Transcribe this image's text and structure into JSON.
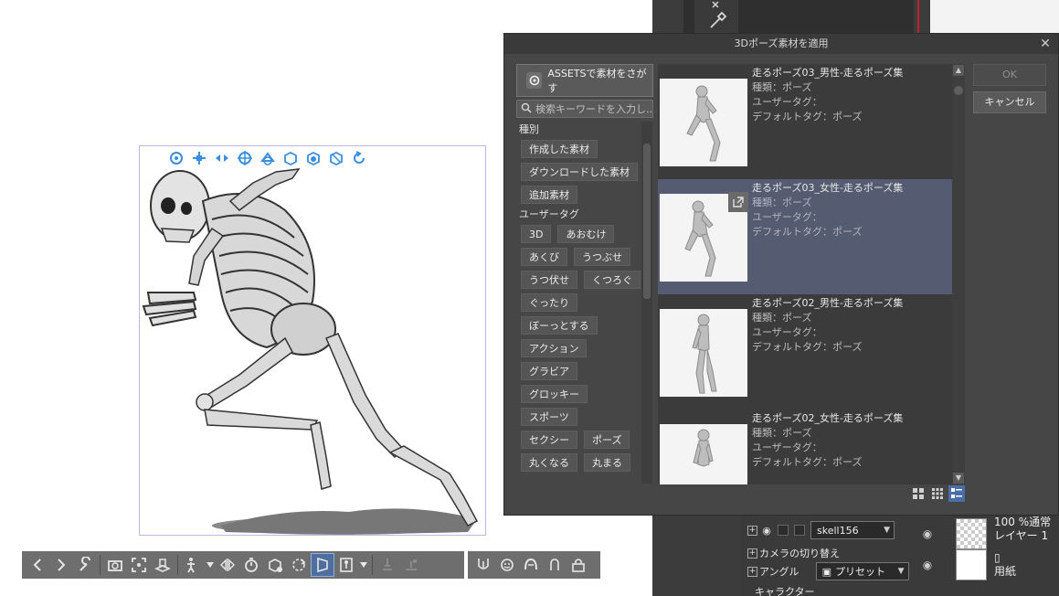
{
  "dialog": {
    "title": "3Dポーズ素材を適用",
    "assets_button": "ASSETSで素材をさがす",
    "search_placeholder": "検索キーワードを入力し...",
    "ok": "OK",
    "cancel": "キャンセル",
    "sections": {
      "kind": "種別",
      "user_tag": "ユーザータグ"
    },
    "kind_tags": [
      "作成した素材",
      "ダウンロードした素材",
      "追加素材"
    ],
    "user_tags": [
      "3D",
      "あおむけ",
      "あくび",
      "うつぶせ",
      "うつ伏せ",
      "くつろぐ",
      "ぐったり",
      "ぼーっとする",
      "アクション",
      "グラビア",
      "グロッキー",
      "スポーツ",
      "セクシー",
      "ポーズ",
      "丸くなる",
      "丸まる"
    ],
    "materials": [
      {
        "name": "走るポーズ03_男性-走るポーズ集",
        "kind": "種類：ポーズ",
        "user_tag": "ユーザータグ：",
        "default_tag": "デフォルトタグ：ポーズ"
      },
      {
        "name": "走るポーズ03_女性-走るポーズ集",
        "kind": "種類：ポーズ",
        "user_tag": "ユーザータグ：",
        "default_tag": "デフォルトタグ：ポーズ"
      },
      {
        "name": "走るポーズ02_男性-走るポーズ集",
        "kind": "種類：ポーズ",
        "user_tag": "ユーザータグ：",
        "default_tag": "デフォルトタグ：ポーズ"
      },
      {
        "name": "走るポーズ02_女性-走るポーズ集",
        "kind": "種類：ポーズ",
        "user_tag": "ユーザータグ：",
        "default_tag": "デフォルトタグ：ポーズ"
      }
    ]
  },
  "layer_panel": {
    "object_name": "skell156",
    "camera_switch": "カメラの切り替え",
    "angle": "アングル",
    "preset": "プリセット",
    "character": "キャラクター"
  },
  "layers": [
    {
      "blend": "100 %通常",
      "name": "レイヤー 1"
    },
    {
      "name": "用紙"
    }
  ],
  "colors": {
    "dialog_bg": "#464646",
    "selected_item": "#555b70",
    "toolbar_bg": "#6e6e6e",
    "gizmo_blue": "#3a8ee0",
    "accent_red": "#c0212b"
  }
}
